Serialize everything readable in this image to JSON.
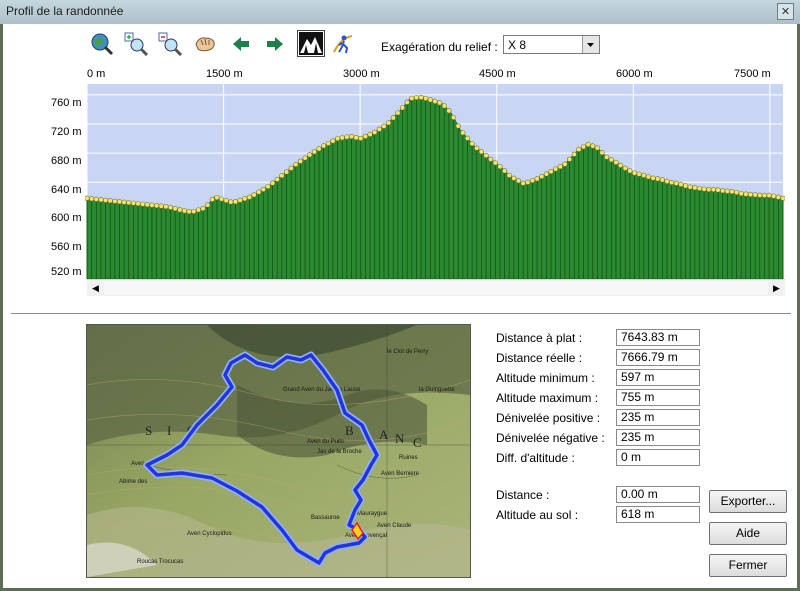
{
  "window": {
    "title": "Profil de la randonnée",
    "close_glyph": "✕"
  },
  "toolbar": {
    "icons": [
      "globe-zoom-icon",
      "zoom-in-icon",
      "zoom-out-icon",
      "hand-pan-icon",
      "arrow-left-icon",
      "arrow-right-icon",
      "relief-mountain-icon",
      "walker-route-icon"
    ],
    "exag_label": "Exagération du relief :",
    "exag_value": "X 8"
  },
  "chart_data": {
    "type": "area",
    "x_unit": "m",
    "y_unit": "m",
    "x_ticks": [
      "0 m",
      "1500 m",
      "3000 m",
      "4500 m",
      "6000 m",
      "7500 m"
    ],
    "y_ticks": [
      "760 m",
      "720 m",
      "680 m",
      "640 m",
      "600 m",
      "560 m",
      "520 m"
    ],
    "xlim": [
      0,
      7644
    ],
    "ylim": [
      507,
      775
    ],
    "x": [
      0,
      300,
      600,
      900,
      1050,
      1150,
      1300,
      1400,
      1600,
      1800,
      2000,
      2150,
      2300,
      2450,
      2600,
      2750,
      2900,
      3000,
      3150,
      3300,
      3450,
      3550,
      3650,
      3700,
      3800,
      3900,
      4000,
      4100,
      4250,
      4400,
      4550,
      4650,
      4800,
      4950,
      5100,
      5250,
      5400,
      5500,
      5600,
      5700,
      5800,
      5900,
      6000,
      6100,
      6200,
      6300,
      6400,
      6500,
      6600,
      6700,
      6800,
      6900,
      7000,
      7100,
      7200,
      7300,
      7400,
      7500,
      7644
    ],
    "y": [
      618,
      614,
      610,
      606,
      601,
      599,
      605,
      620,
      612,
      620,
      635,
      650,
      665,
      678,
      690,
      700,
      703,
      700,
      708,
      720,
      740,
      755,
      757,
      756,
      752,
      748,
      735,
      712,
      690,
      675,
      660,
      648,
      638,
      645,
      655,
      665,
      685,
      692,
      688,
      675,
      668,
      660,
      653,
      650,
      646,
      644,
      640,
      638,
      634,
      632,
      630,
      630,
      628,
      627,
      624,
      623,
      622,
      622,
      618
    ],
    "fill_color": "#2a8a30",
    "sky_color": "#c8d6f4",
    "marker_color": "#f3e46e",
    "grid": true
  },
  "stats": [
    {
      "label": "Distance à plat :",
      "value": "7643.83 m"
    },
    {
      "label": "Distance réelle :",
      "value": "7666.79 m"
    },
    {
      "label": "Altitude minimum :",
      "value": "597 m"
    },
    {
      "label": "Altitude maximum :",
      "value": "755 m"
    },
    {
      "label": "Dénivelée positive :",
      "value": "235 m"
    },
    {
      "label": "Dénivelée négative :",
      "value": "235 m"
    },
    {
      "label": "Diff. d'altitude :",
      "value": "0 m"
    }
  ],
  "cursor": [
    {
      "label": "Distance :",
      "value": "0.00 m"
    },
    {
      "label": "Altitude au sol :",
      "value": "618 m"
    }
  ],
  "buttons": {
    "export": "Exporter...",
    "help": "Aide",
    "close": "Fermer"
  },
  "map": {
    "labels": [
      "le Clot de Perry",
      "Grand Aven du Jas de Lause",
      "la Guinguette",
      "S",
      "I",
      "O",
      "B",
      "L",
      "A",
      "N",
      "C",
      "Aven du Puits",
      "Jas de la Broche",
      "Aven Berniere",
      "Aven Claude",
      "Aven Provençal",
      "Roucas Trocucas",
      "Abime des",
      "Aven Cyclopidus",
      "Bassauroe",
      "Mauraygue",
      "Aven",
      "Ruines"
    ],
    "route_color": "#2433e0"
  }
}
